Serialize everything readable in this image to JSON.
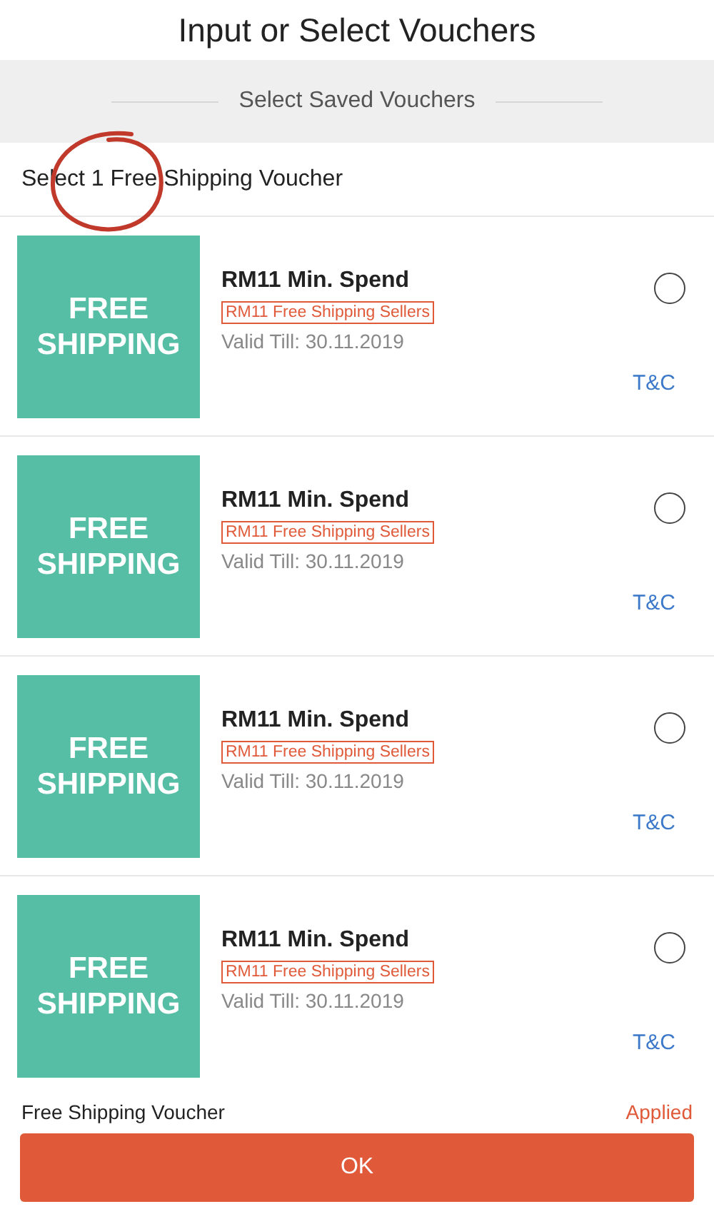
{
  "title": "Input or Select Vouchers",
  "section_header": "Select Saved Vouchers",
  "instruction": "Select 1 Free Shipping Voucher",
  "annotations": [
    {
      "kind": "circle",
      "color": "#c0392b"
    }
  ],
  "vouchers": [
    {
      "badge_lines": [
        "FREE",
        "SHIPPING"
      ],
      "min_spend": "RM11 Min. Spend",
      "tag": "RM11 Free Shipping Sellers",
      "valid": "Valid Till: 30.11.2019",
      "terms": "T&C",
      "selected": false
    },
    {
      "badge_lines": [
        "FREE",
        "SHIPPING"
      ],
      "min_spend": "RM11 Min. Spend",
      "tag": "RM11 Free Shipping Sellers",
      "valid": "Valid Till: 30.11.2019",
      "terms": "T&C",
      "selected": false
    },
    {
      "badge_lines": [
        "FREE",
        "SHIPPING"
      ],
      "min_spend": "RM11 Min. Spend",
      "tag": "RM11 Free Shipping Sellers",
      "valid": "Valid Till: 30.11.2019",
      "terms": "T&C",
      "selected": false
    },
    {
      "badge_lines": [
        "FREE",
        "SHIPPING"
      ],
      "min_spend": "RM11 Min. Spend",
      "tag": "RM11 Free Shipping Sellers",
      "valid": "Valid Till: 30.11.2019",
      "terms": "T&C",
      "selected": false
    }
  ],
  "footer": {
    "label": "Free Shipping Voucher",
    "status": "Applied"
  },
  "button": "OK"
}
